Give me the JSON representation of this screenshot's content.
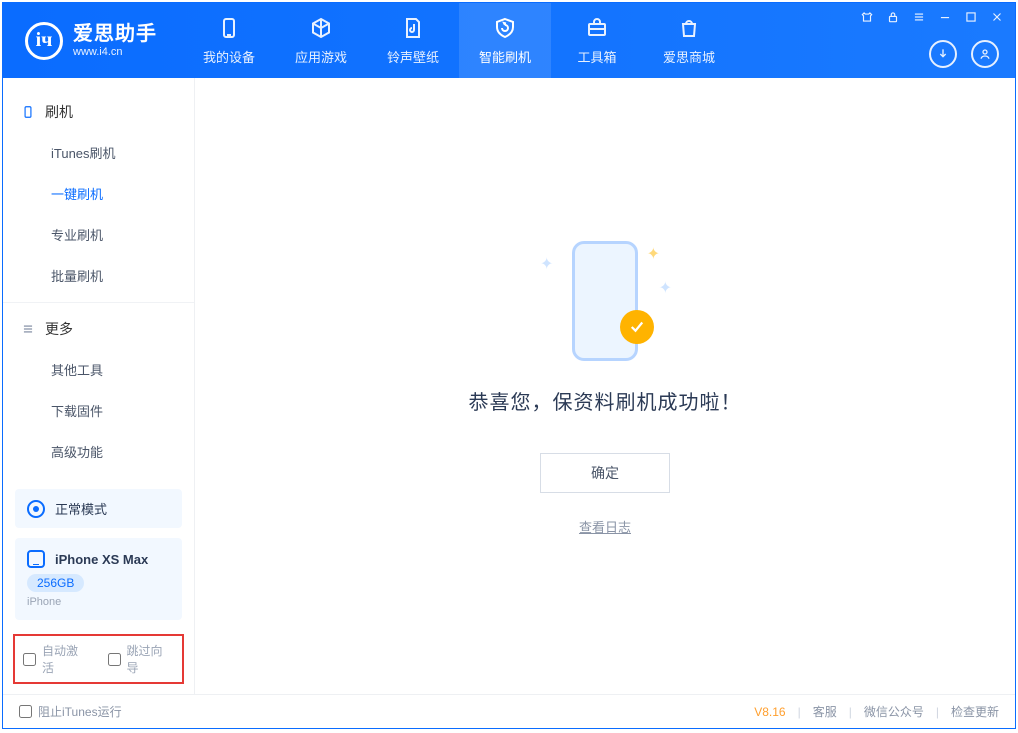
{
  "app": {
    "name": "爱思助手",
    "url": "www.i4.cn"
  },
  "nav": {
    "items": [
      {
        "label": "我的设备"
      },
      {
        "label": "应用游戏"
      },
      {
        "label": "铃声壁纸"
      },
      {
        "label": "智能刷机"
      },
      {
        "label": "工具箱"
      },
      {
        "label": "爱思商城"
      }
    ],
    "activeIndex": 3
  },
  "sidebar": {
    "section1": {
      "title": "刷机",
      "items": [
        "iTunes刷机",
        "一键刷机",
        "专业刷机",
        "批量刷机"
      ],
      "activeIndex": 1
    },
    "section2": {
      "title": "更多",
      "items": [
        "其他工具",
        "下载固件",
        "高级功能"
      ]
    }
  },
  "device": {
    "modeLabel": "正常模式",
    "name": "iPhone XS Max",
    "capacity": "256GB",
    "type": "iPhone"
  },
  "options": {
    "autoActivate": "自动激活",
    "skipGuide": "跳过向导"
  },
  "content": {
    "message": "恭喜您，保资料刷机成功啦！",
    "okButton": "确定",
    "logLink": "查看日志"
  },
  "statusbar": {
    "blockItunes": "阻止iTunes运行",
    "version": "V8.16",
    "links": [
      "客服",
      "微信公众号",
      "检查更新"
    ]
  }
}
